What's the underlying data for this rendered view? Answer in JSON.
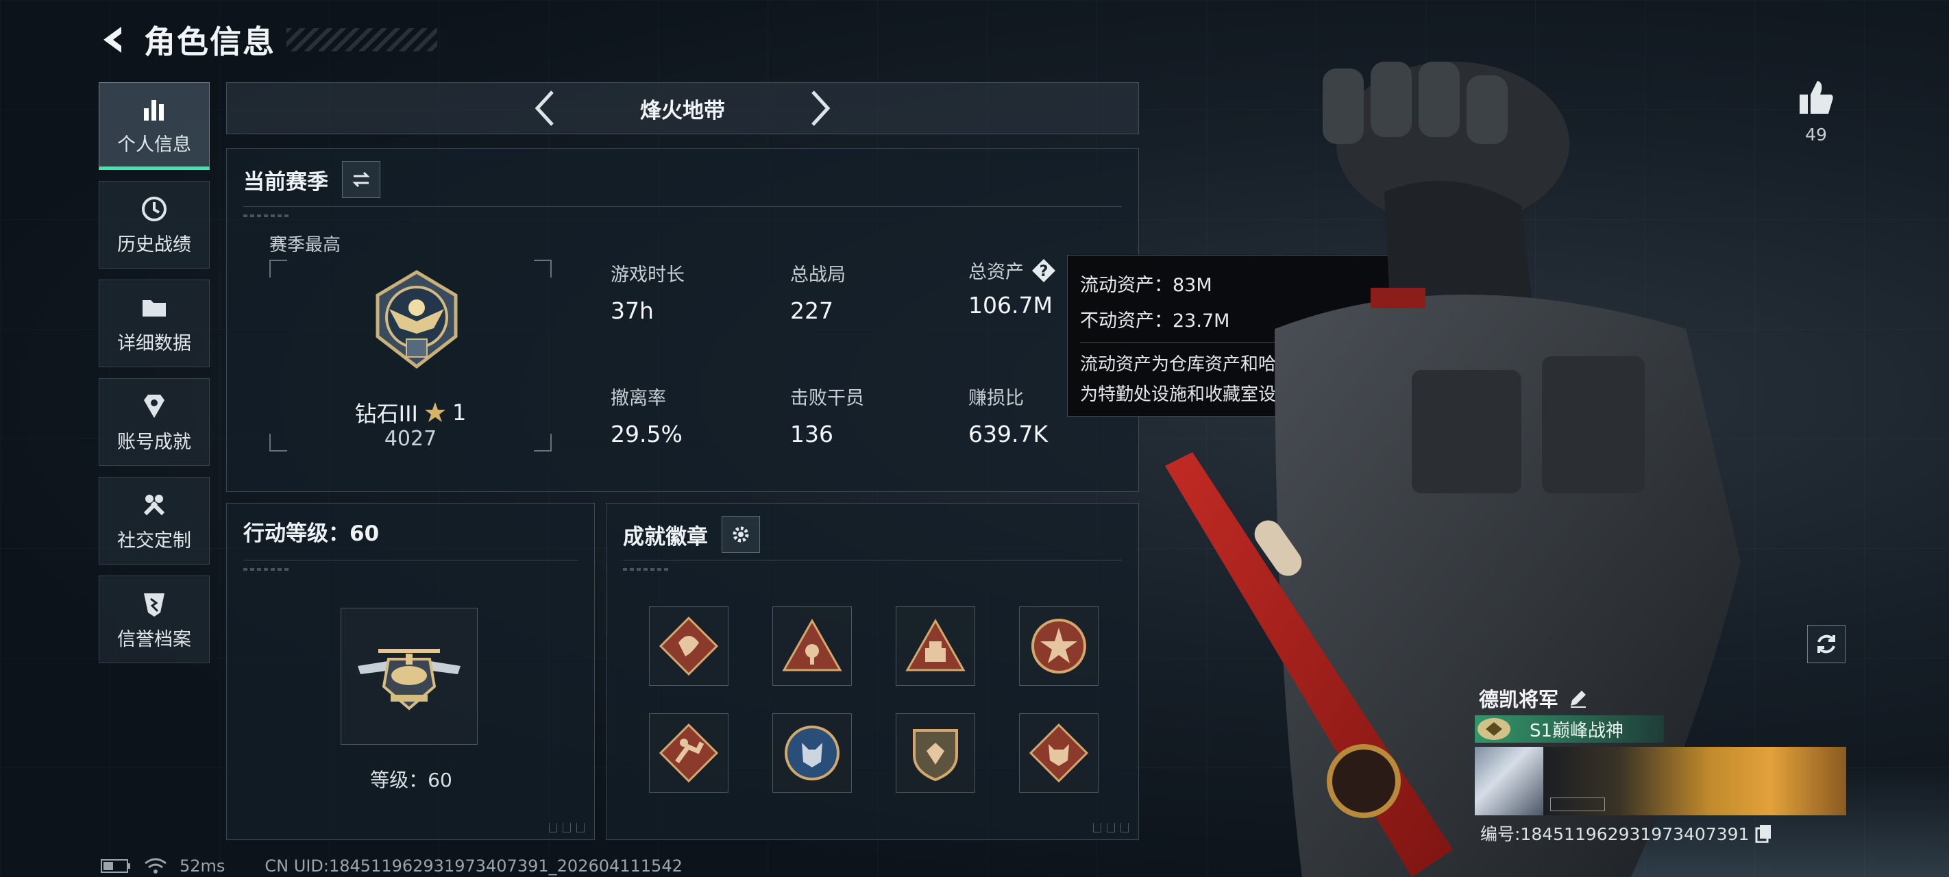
{
  "page_title": "角色信息",
  "nav": [
    {
      "label": "个人信息",
      "icon": "bar-chart-icon",
      "active": true
    },
    {
      "label": "历史战绩",
      "icon": "clock-icon"
    },
    {
      "label": "详细数据",
      "icon": "folder-icon"
    },
    {
      "label": "账号成就",
      "icon": "medal-icon"
    },
    {
      "label": "社交定制",
      "icon": "wrench-icon"
    },
    {
      "label": "信誉档案",
      "icon": "shield-icon"
    }
  ],
  "mode": {
    "title": "烽火地带"
  },
  "season": {
    "title": "当前赛季",
    "best_label": "赛季最高",
    "rank_name": "钻石III",
    "rank_stars": "1",
    "rank_score": "4027",
    "stats": [
      {
        "label": "游戏时长",
        "value": "37h"
      },
      {
        "label": "总战局",
        "value": "227"
      },
      {
        "label": "总资产",
        "value": "106.7M"
      },
      {
        "label": "撤离率",
        "value": "29.5%"
      },
      {
        "label": "击败干员",
        "value": "136"
      },
      {
        "label": "赚损比",
        "value": "639.7K"
      }
    ]
  },
  "tooltip": {
    "line1": "流动资产：83M",
    "line2": "不动资产：23.7M",
    "desc1": "流动资产为仓库资产和哈夫币，不动资产",
    "desc2": "为特勤处设施和收藏室设施"
  },
  "level": {
    "title": "行动等级：60",
    "text": "等级：60"
  },
  "badges": {
    "title": "成就徽章",
    "count": 8
  },
  "likes": "49",
  "player": {
    "name": "德凯将军",
    "title": "S1巅峰战神",
    "id_text": "编号:18451196293197340739​1"
  },
  "status": {
    "ping": "52ms",
    "uid": "CN UID:184511962931973407391_202604111542"
  },
  "colors": {
    "accent": "#3ee6b0",
    "gold": "#d7b36a",
    "badge_red": "#8c3a2c"
  }
}
